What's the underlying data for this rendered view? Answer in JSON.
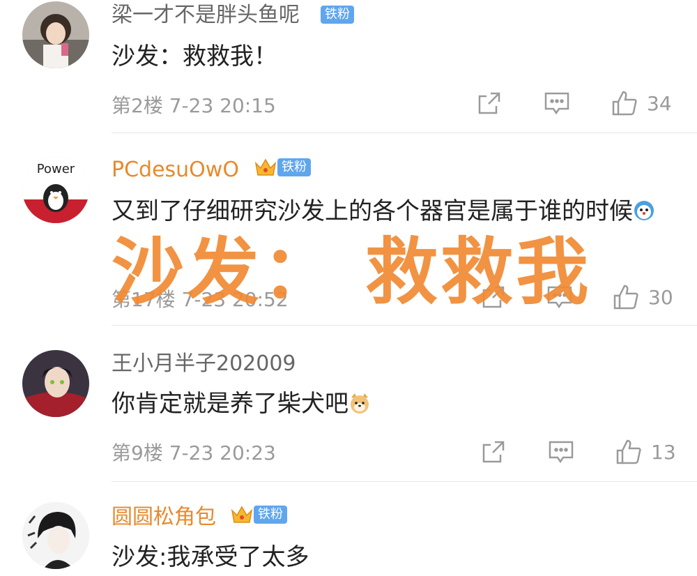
{
  "comments": [
    {
      "username": "梁一才不是胖头鱼呢",
      "badge": "铁粉",
      "content": "沙发：救救我！",
      "floor_time": "第2楼  7-23 20:15",
      "likes": "34"
    },
    {
      "username": "PCdesuOwO",
      "badge": "铁粉",
      "content": "又到了仔细研究沙发上的各个器官是属于谁的时候",
      "floor_time": "第17楼  7-23 20:52",
      "likes": "30"
    },
    {
      "username": "王小月半子202009",
      "content": "你肯定就是养了柴犬吧",
      "floor_time": "第9楼  7-23 20:23",
      "likes": "13"
    },
    {
      "username": "圆圆松角包",
      "badge": "铁粉",
      "content": "沙发:我承受了太多"
    }
  ],
  "overlay_caption": "沙发： 救救我",
  "colors": {
    "vip_name": "#e8892b",
    "normal_name": "#666666",
    "fan_badge": "#5fa6ee",
    "overlay": "#f08a34",
    "meta": "#9a9a9a"
  },
  "icons": [
    "share-icon",
    "reply-icon",
    "like-icon",
    "crown-icon",
    "doge-emoji",
    "shiba-emoji"
  ]
}
